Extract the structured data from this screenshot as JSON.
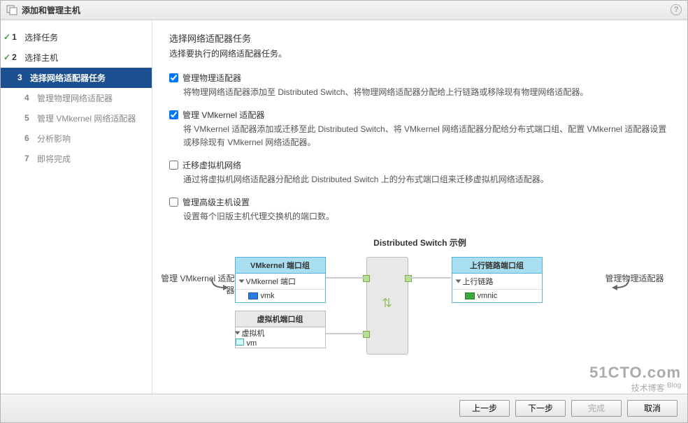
{
  "titlebar": {
    "title": "添加和管理主机"
  },
  "sidebar": {
    "steps": [
      {
        "num": "1",
        "label": "选择任务"
      },
      {
        "num": "2",
        "label": "选择主机"
      },
      {
        "num": "3",
        "label": "选择网络适配器任务"
      },
      {
        "num": "4",
        "label": "管理物理网络适配器"
      },
      {
        "num": "5",
        "label": "管理 VMkernel 网络适配器"
      },
      {
        "num": "6",
        "label": "分析影响"
      },
      {
        "num": "7",
        "label": "即将完成"
      }
    ]
  },
  "main": {
    "title": "选择网络适配器任务",
    "subtitle": "选择要执行的网络适配器任务。",
    "options": [
      {
        "label": "管理物理适配器",
        "desc": "将物理网络适配器添加至 Distributed Switch、将物理网络适配器分配给上行链路或移除现有物理网络适配器。"
      },
      {
        "label": "管理 VMkernel 适配器",
        "desc": "将 VMkernel 适配器添加或迁移至此 Distributed Switch、将 VMkernel 网络适配器分配给分布式端口组、配置 VMkernel 适配器设置或移除现有 VMkernel 网络适配器。"
      },
      {
        "label": "迁移虚拟机网络",
        "desc": "通过将虚拟机网络适配器分配给此 Distributed Switch 上的分布式端口组来迁移虚拟机网络适配器。"
      },
      {
        "label": "管理高级主机设置",
        "desc": "设置每个旧版主机代理交换机的端口数。"
      }
    ]
  },
  "diagram": {
    "title": "Distributed Switch 示例",
    "left_label": "管理 VMkernel 适配器",
    "right_label": "管理物理适配器",
    "vmk_group": {
      "header": "VMkernel 端口组",
      "row": "VMkernel 端口",
      "item": "vmk"
    },
    "uplink_group": {
      "header": "上行链路端口组",
      "row": "上行链路",
      "item": "vmnic"
    },
    "vm_group": {
      "header": "虚拟机端口组",
      "row": "虚拟机",
      "item": "vm"
    }
  },
  "footer": {
    "back": "上一步",
    "next": "下一步",
    "finish": "完成",
    "cancel": "取消"
  },
  "watermark": {
    "big": "51CTO.com",
    "small": "技术博客",
    "blog": "Blog"
  }
}
